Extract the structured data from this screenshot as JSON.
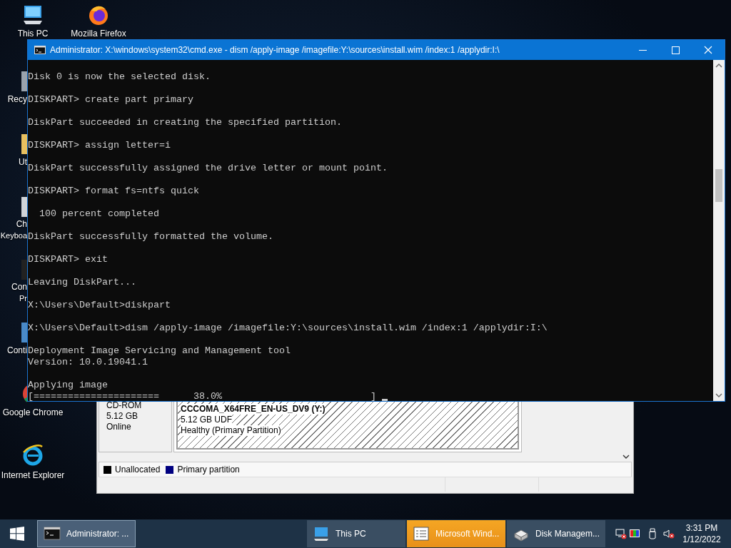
{
  "desktop_icons": [
    {
      "label": "This PC",
      "kind": "pc"
    },
    {
      "label": "Mozilla Firefox",
      "kind": "firefox"
    },
    {
      "label": "Recy",
      "kind": "bin"
    },
    {
      "label": "Ut",
      "kind": "folder"
    },
    {
      "label": "Ch",
      "label2": "Keyboa",
      "kind": "keyboard"
    },
    {
      "label": "Con",
      "label2": "Pr",
      "kind": "console"
    },
    {
      "label": "Conti",
      "kind": "panel"
    },
    {
      "label": "Google Chrome",
      "kind": "chrome"
    },
    {
      "label": "Internet Explorer",
      "kind": "ie"
    }
  ],
  "disk_management": {
    "disk_info": [
      "CD-ROM",
      "5.12 GB",
      "Online"
    ],
    "partition": {
      "name": "CCCOMA_X64FRE_EN-US_DV9  (Y:)",
      "size": "5.12 GB UDF",
      "status": "Healthy (Primary Partition)"
    },
    "legend": [
      {
        "label": "Unallocated",
        "color": "#000000"
      },
      {
        "label": "Primary partition",
        "color": "#000080"
      }
    ]
  },
  "console_window": {
    "title": "Administrator: X:\\windows\\system32\\cmd.exe - dism  /apply-image /imagefile:Y:\\sources\\install.wim /index:1 /applydir:I:\\",
    "blocks": [
      [
        "Disk 0 is now the selected disk."
      ],
      [
        "DISKPART> create part primary"
      ],
      [
        "DiskPart succeeded in creating the specified partition."
      ],
      [
        "DISKPART> assign letter=i"
      ],
      [
        "DiskPart successfully assigned the drive letter or mount point."
      ],
      [
        "DISKPART> format fs=ntfs quick"
      ],
      [
        "  100 percent completed"
      ],
      [
        "DiskPart successfully formatted the volume."
      ],
      [
        "DISKPART> exit"
      ],
      [
        "Leaving DiskPart..."
      ],
      [
        "X:\\Users\\Default>diskpart"
      ],
      [
        "X:\\Users\\Default>dism /apply-image /imagefile:Y:\\sources\\install.wim /index:1 /applydir:I:\\"
      ],
      [
        "Deployment Image Servicing and Management tool",
        "Version: 10.0.19041.1"
      ],
      [
        "Applying image",
        "[======================      38.0%                          ] "
      ]
    ]
  },
  "taskbar": {
    "buttons": [
      {
        "label": "Administrator: ...",
        "kind": "cmd",
        "selected": true,
        "flashing": false
      },
      {
        "label": "This PC",
        "kind": "pc",
        "selected": false,
        "flashing": false
      },
      {
        "label": "Microsoft Wind...",
        "kind": "doc",
        "selected": false,
        "flashing": true
      },
      {
        "label": "Disk Managem...",
        "kind": "disk",
        "selected": false,
        "flashing": false
      }
    ],
    "time": "3:31 PM",
    "date": "1/12/2022"
  }
}
